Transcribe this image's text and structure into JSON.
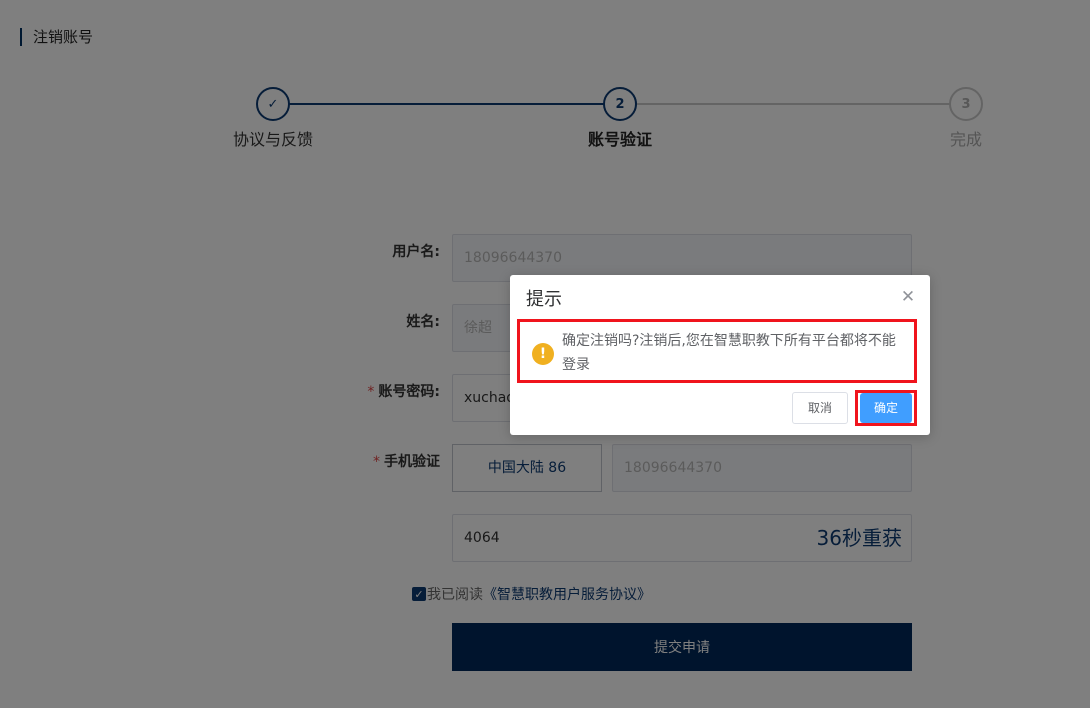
{
  "page": {
    "title": "注销账号"
  },
  "steps": [
    {
      "icon": "✓",
      "label": "协议与反馈"
    },
    {
      "number": "2",
      "label": "账号验证"
    },
    {
      "number": "3",
      "label": "完成"
    }
  ],
  "form": {
    "username": {
      "label": "用户名:",
      "value": "18096644370"
    },
    "name": {
      "label": "姓名:",
      "value": "徐超"
    },
    "password": {
      "required_mark": "*",
      "label": "账号密码:",
      "value": "xuchao"
    },
    "phone": {
      "required_mark": "*",
      "label": "手机验证",
      "region": "中国大陆 86",
      "value": "18096644370"
    },
    "code": {
      "value": "4064",
      "countdown": "36秒重获"
    },
    "agreement": {
      "text": "我已阅读",
      "link": "《智慧职教用户服务协议》",
      "checked": true
    },
    "submit_label": "提交申请"
  },
  "dialog": {
    "title": "提示",
    "message": "确定注销吗?注销后,您在智慧职教下所有平台都将不能登录",
    "cancel_label": "取消",
    "confirm_label": "确定"
  }
}
